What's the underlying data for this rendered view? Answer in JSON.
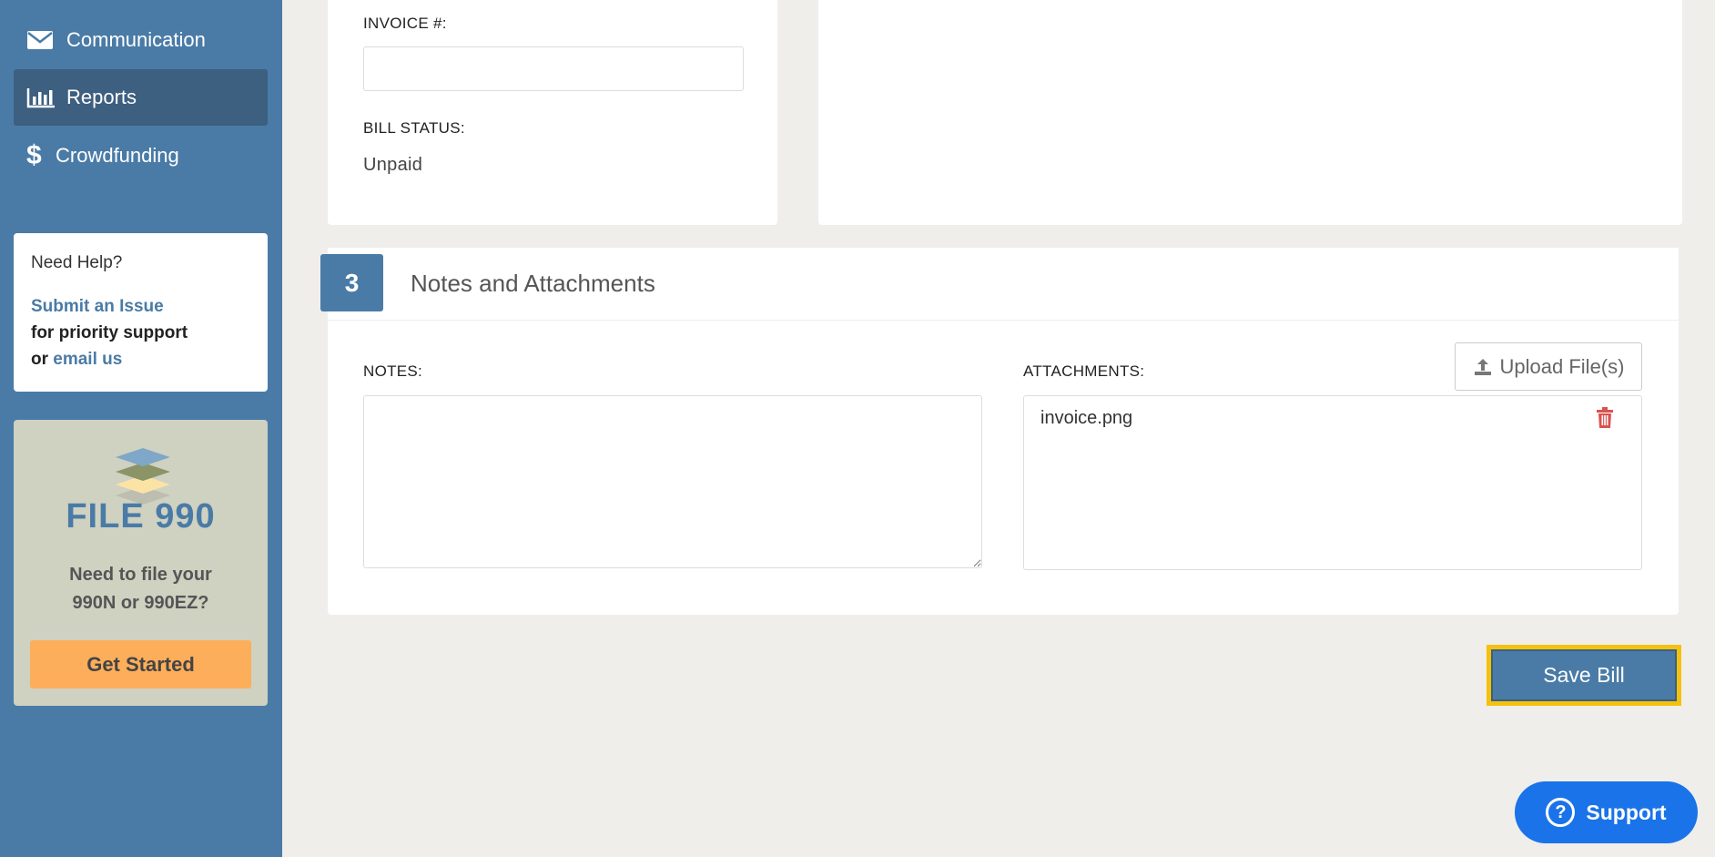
{
  "sidebar": {
    "items": [
      {
        "label": "Communication",
        "icon": "envelope-icon"
      },
      {
        "label": "Reports",
        "icon": "bar-chart-icon",
        "active": true
      },
      {
        "label": "Crowdfunding",
        "icon": "dollar-icon",
        "glyph": "$"
      }
    ],
    "help": {
      "title": "Need Help?",
      "submit_link": "Submit an Issue",
      "support_text": "for priority support",
      "or_text": "or",
      "email_link": "email us"
    },
    "promo": {
      "title": "FILE 990",
      "desc_line1": "Need to file your",
      "desc_line2": "990N or 990EZ?",
      "button": "Get Started"
    }
  },
  "bill": {
    "invoice_label": "INVOICE #:",
    "invoice_value": "",
    "status_label": "BILL STATUS:",
    "status_value": "Unpaid"
  },
  "section3": {
    "number": "3",
    "title": "Notes and Attachments",
    "notes_label": "NOTES:",
    "notes_value": "",
    "attachments_label": "ATTACHMENTS:",
    "upload_button": "Upload File(s)",
    "attachments": [
      "invoice.png"
    ]
  },
  "actions": {
    "save": "Save Bill",
    "support": "Support",
    "support_glyph": "?"
  },
  "colors": {
    "sidebar": "#4a7ba6",
    "sidebar_active": "#3d5f80",
    "accent_orange": "#fdae5b",
    "highlight": "#f4c20d",
    "support_blue": "#1a73e8",
    "danger": "#d9534f"
  }
}
